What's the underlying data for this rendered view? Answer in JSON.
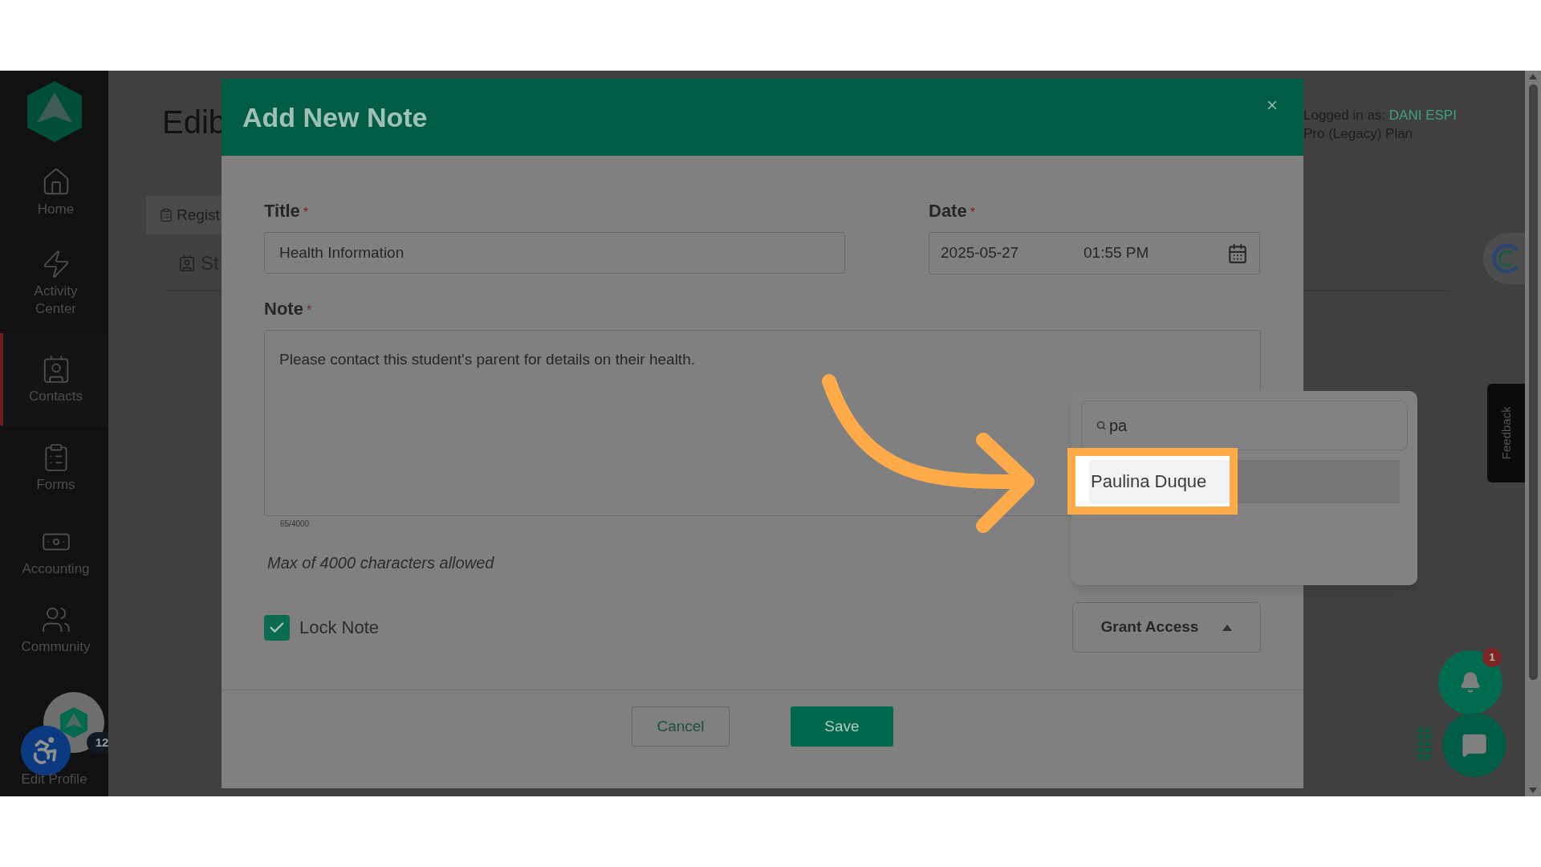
{
  "sidebar": {
    "items": [
      {
        "label": "Home",
        "kind": "home",
        "selected": false
      },
      {
        "label": "Activity Center",
        "kind": "activity",
        "selected": false
      },
      {
        "label": "Contacts",
        "kind": "contacts",
        "selected": true
      },
      {
        "label": "Forms",
        "kind": "forms",
        "selected": false
      },
      {
        "label": "Accounting",
        "kind": "accounting",
        "selected": false
      },
      {
        "label": "Community",
        "kind": "community",
        "selected": false
      }
    ],
    "profile": {
      "label": "Edit Profile",
      "badge": "12"
    }
  },
  "page": {
    "title": "Edib",
    "tab": "Regist",
    "section": "St",
    "account": {
      "prefix": "Logged in as:",
      "user": "DANI ESPI",
      "plan": "Pro (Legacy) Plan"
    }
  },
  "feedback": "Feedback",
  "notifications": {
    "count": "1"
  },
  "modal": {
    "title": "Add New Note",
    "title_field": {
      "label": "Title",
      "mark": "*",
      "value": "Health Information"
    },
    "date_field": {
      "label": "Date",
      "mark": "*",
      "date": "2025-05-27",
      "time": "01:55 PM"
    },
    "note_field": {
      "label": "Note",
      "mark": "*",
      "value": "Please contact this student's parent for details on their health.",
      "counter": "65/4000",
      "hint": "Max of 4000 characters allowed"
    },
    "lock": {
      "label": "Lock Note",
      "checked": true
    },
    "grant": {
      "label": "Grant Access",
      "expanded": true
    },
    "dropdown": {
      "search": "pa",
      "options": [
        {
          "label": "Paulina Duque",
          "selected": true
        }
      ]
    },
    "buttons": {
      "cancel": "Cancel",
      "save": "Save"
    }
  }
}
